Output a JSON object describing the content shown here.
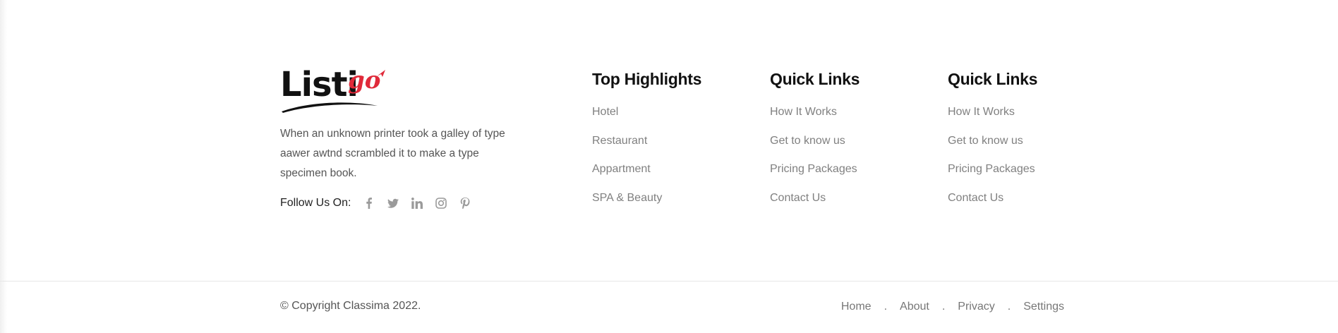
{
  "brand": {
    "logo_text": "Listi",
    "logo_script": "go",
    "description": "When an unknown printer took a galley of type aawer awtnd scrambled it to make a type specimen book.",
    "follow_label": "Follow Us On:",
    "social_icons": [
      "facebook-icon",
      "twitter-icon",
      "linkedin-icon",
      "instagram-icon",
      "pinterest-icon"
    ],
    "accent_color": "#e02a3a"
  },
  "columns": [
    {
      "title": "Top Highlights",
      "links": [
        "Hotel",
        "Restaurant",
        "Appartment",
        "SPA & Beauty"
      ]
    },
    {
      "title": "Quick Links",
      "links": [
        "How It Works",
        "Get to know us",
        "Pricing Packages",
        "Contact Us"
      ]
    },
    {
      "title": "Quick Links",
      "links": [
        "How It Works",
        "Get to know us",
        "Pricing Packages",
        "Contact Us"
      ]
    }
  ],
  "bottom": {
    "copyright": "© Copyright Classima 2022.",
    "nav": [
      "Home",
      "About",
      "Privacy",
      "Settings"
    ],
    "separator": "."
  }
}
